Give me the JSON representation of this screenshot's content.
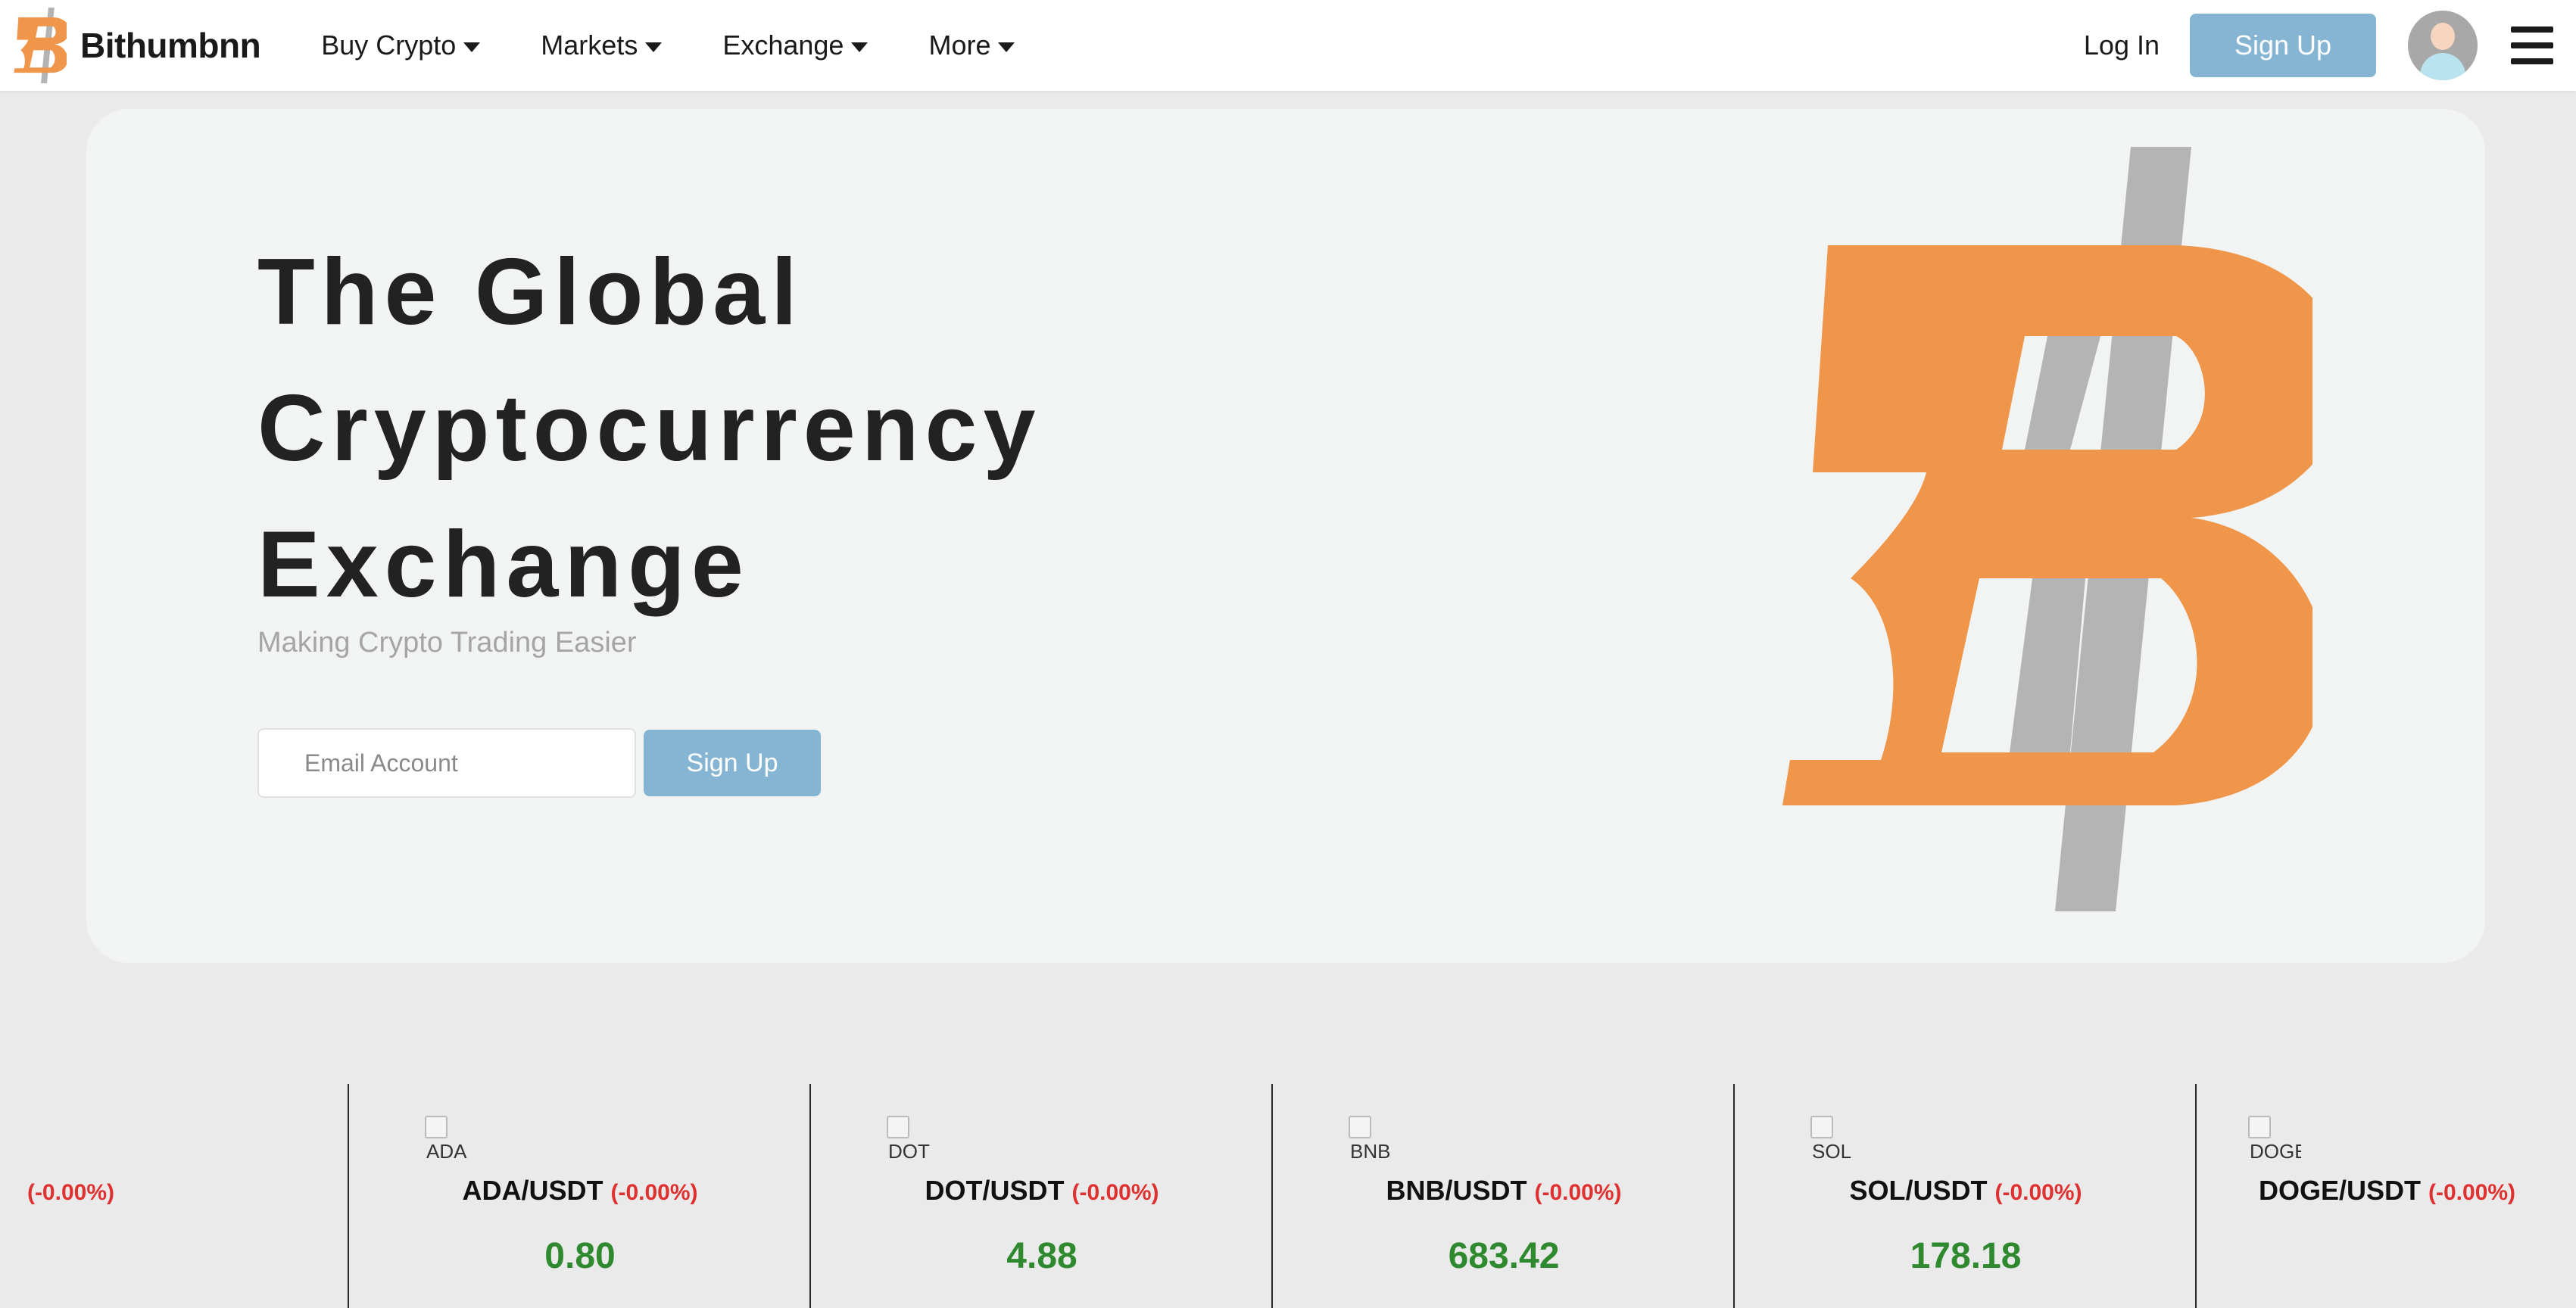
{
  "nav": {
    "brand_name": "Bithumbnn",
    "menu": [
      {
        "label": "Buy Crypto"
      },
      {
        "label": "Markets"
      },
      {
        "label": "Exchange"
      },
      {
        "label": "More"
      }
    ],
    "login_label": "Log In",
    "signup_label": "Sign Up"
  },
  "hero": {
    "title_lines": [
      "The Global",
      "Cryptocurrency",
      "Exchange"
    ],
    "subtitle": "Making Crypto Trading Easier",
    "email_placeholder": "Email Account",
    "signup_label": "Sign Up"
  },
  "ticker": [
    {
      "icon_alt": "",
      "pair": "",
      "change": "(-0.00%)",
      "price": ""
    },
    {
      "icon_alt": "ADA",
      "pair": "ADA/USDT",
      "change": "(-0.00%)",
      "price": "0.80"
    },
    {
      "icon_alt": "DOT",
      "pair": "DOT/USDT",
      "change": "(-0.00%)",
      "price": "4.88"
    },
    {
      "icon_alt": "BNB",
      "pair": "BNB/USDT",
      "change": "(-0.00%)",
      "price": "683.42"
    },
    {
      "icon_alt": "SOL",
      "pair": "SOL/USDT",
      "change": "(-0.00%)",
      "price": "178.18"
    },
    {
      "icon_alt": "DOGE",
      "pair": "DOGE/USDT",
      "change": "(-0.00%)",
      "price": ""
    }
  ],
  "colors": {
    "brand_orange": "#f0964a",
    "logo_gray": "#b4b4b4",
    "button_blue": "#86b5d4",
    "negative_red": "#e03131",
    "price_green": "#2f8a2f"
  },
  "icons": {
    "brand": "bithumb-b-logo-icon",
    "avatar": "user-avatar-icon",
    "menu": "hamburger-menu-icon"
  }
}
